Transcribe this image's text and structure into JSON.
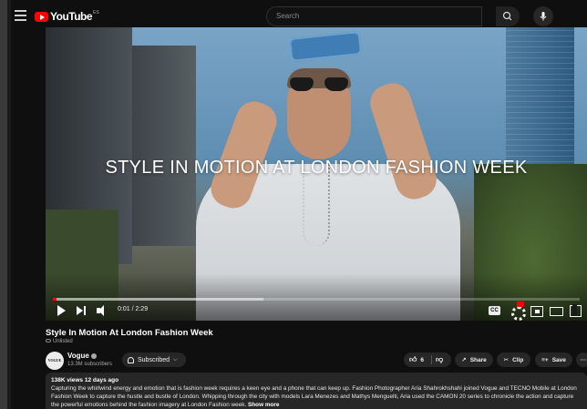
{
  "header": {
    "logo_text": "YouTube",
    "region": "ES",
    "search_placeholder": "Search"
  },
  "video": {
    "headline": "STYLE IN MOTION AT LONDON FASHION WEEK",
    "time": "0:01 / 2:29",
    "progress_played": 0.007,
    "progress_buffered": 0.4
  },
  "info": {
    "title": "Style In Motion At London Fashion Week",
    "visibility": "Unlisted",
    "channel": {
      "avatar_text": "VOGUE",
      "name": "Vogue",
      "subscribers": "13.3M subscribers"
    },
    "subscribe_label": "Subscribed",
    "likes": "6",
    "share_label": "Share",
    "clip_label": "Clip",
    "save_label": "Save",
    "more_label": "···"
  },
  "description": {
    "meta": "138K views  12 days ago",
    "text": "Capturing the whirlwind energy and emotion that is fashion week requires a keen eye and a phone that can keep up. Fashion Photographer Aria Shahrokhshahi joined Vogue and TECNO Mobile at London Fashion Week to capture the hustle and bustle of London. Whipping through the city with models Lara Menezes and Mathys Menguelti, Aria used the CAMON 20 series to chronicle the action and capture the powerful emotions behind the fashion imagery at London Fashion week.",
    "show_more": "Show more"
  },
  "colors": {
    "background": "#0f0f0f",
    "accent": "#ff0000",
    "pill": "#272727"
  }
}
